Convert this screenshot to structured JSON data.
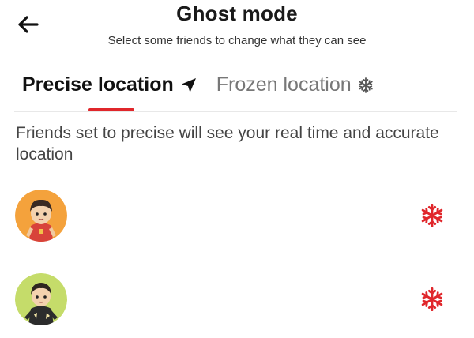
{
  "header": {
    "title": "Ghost mode",
    "subtitle": "Select some friends to change what they can see",
    "back_icon": "arrow-left-icon"
  },
  "tabs": [
    {
      "label": "Precise location",
      "icon": "navigation-arrow-icon",
      "active": true
    },
    {
      "label": "Frozen location",
      "icon": "snowflake-icon",
      "active": false
    }
  ],
  "colors": {
    "accent": "#e0262b",
    "avatar_1_bg": "#f4a23c",
    "avatar_2_bg": "#c5dc6a"
  },
  "description": "Friends set to precise will see your real time and accurate location",
  "friends": [
    {
      "avatar_icon": "cartoon-avatar-basketball-player",
      "action_icon": "snowflake-icon"
    },
    {
      "avatar_icon": "cartoon-avatar-dark-jacket",
      "action_icon": "snowflake-icon"
    }
  ]
}
